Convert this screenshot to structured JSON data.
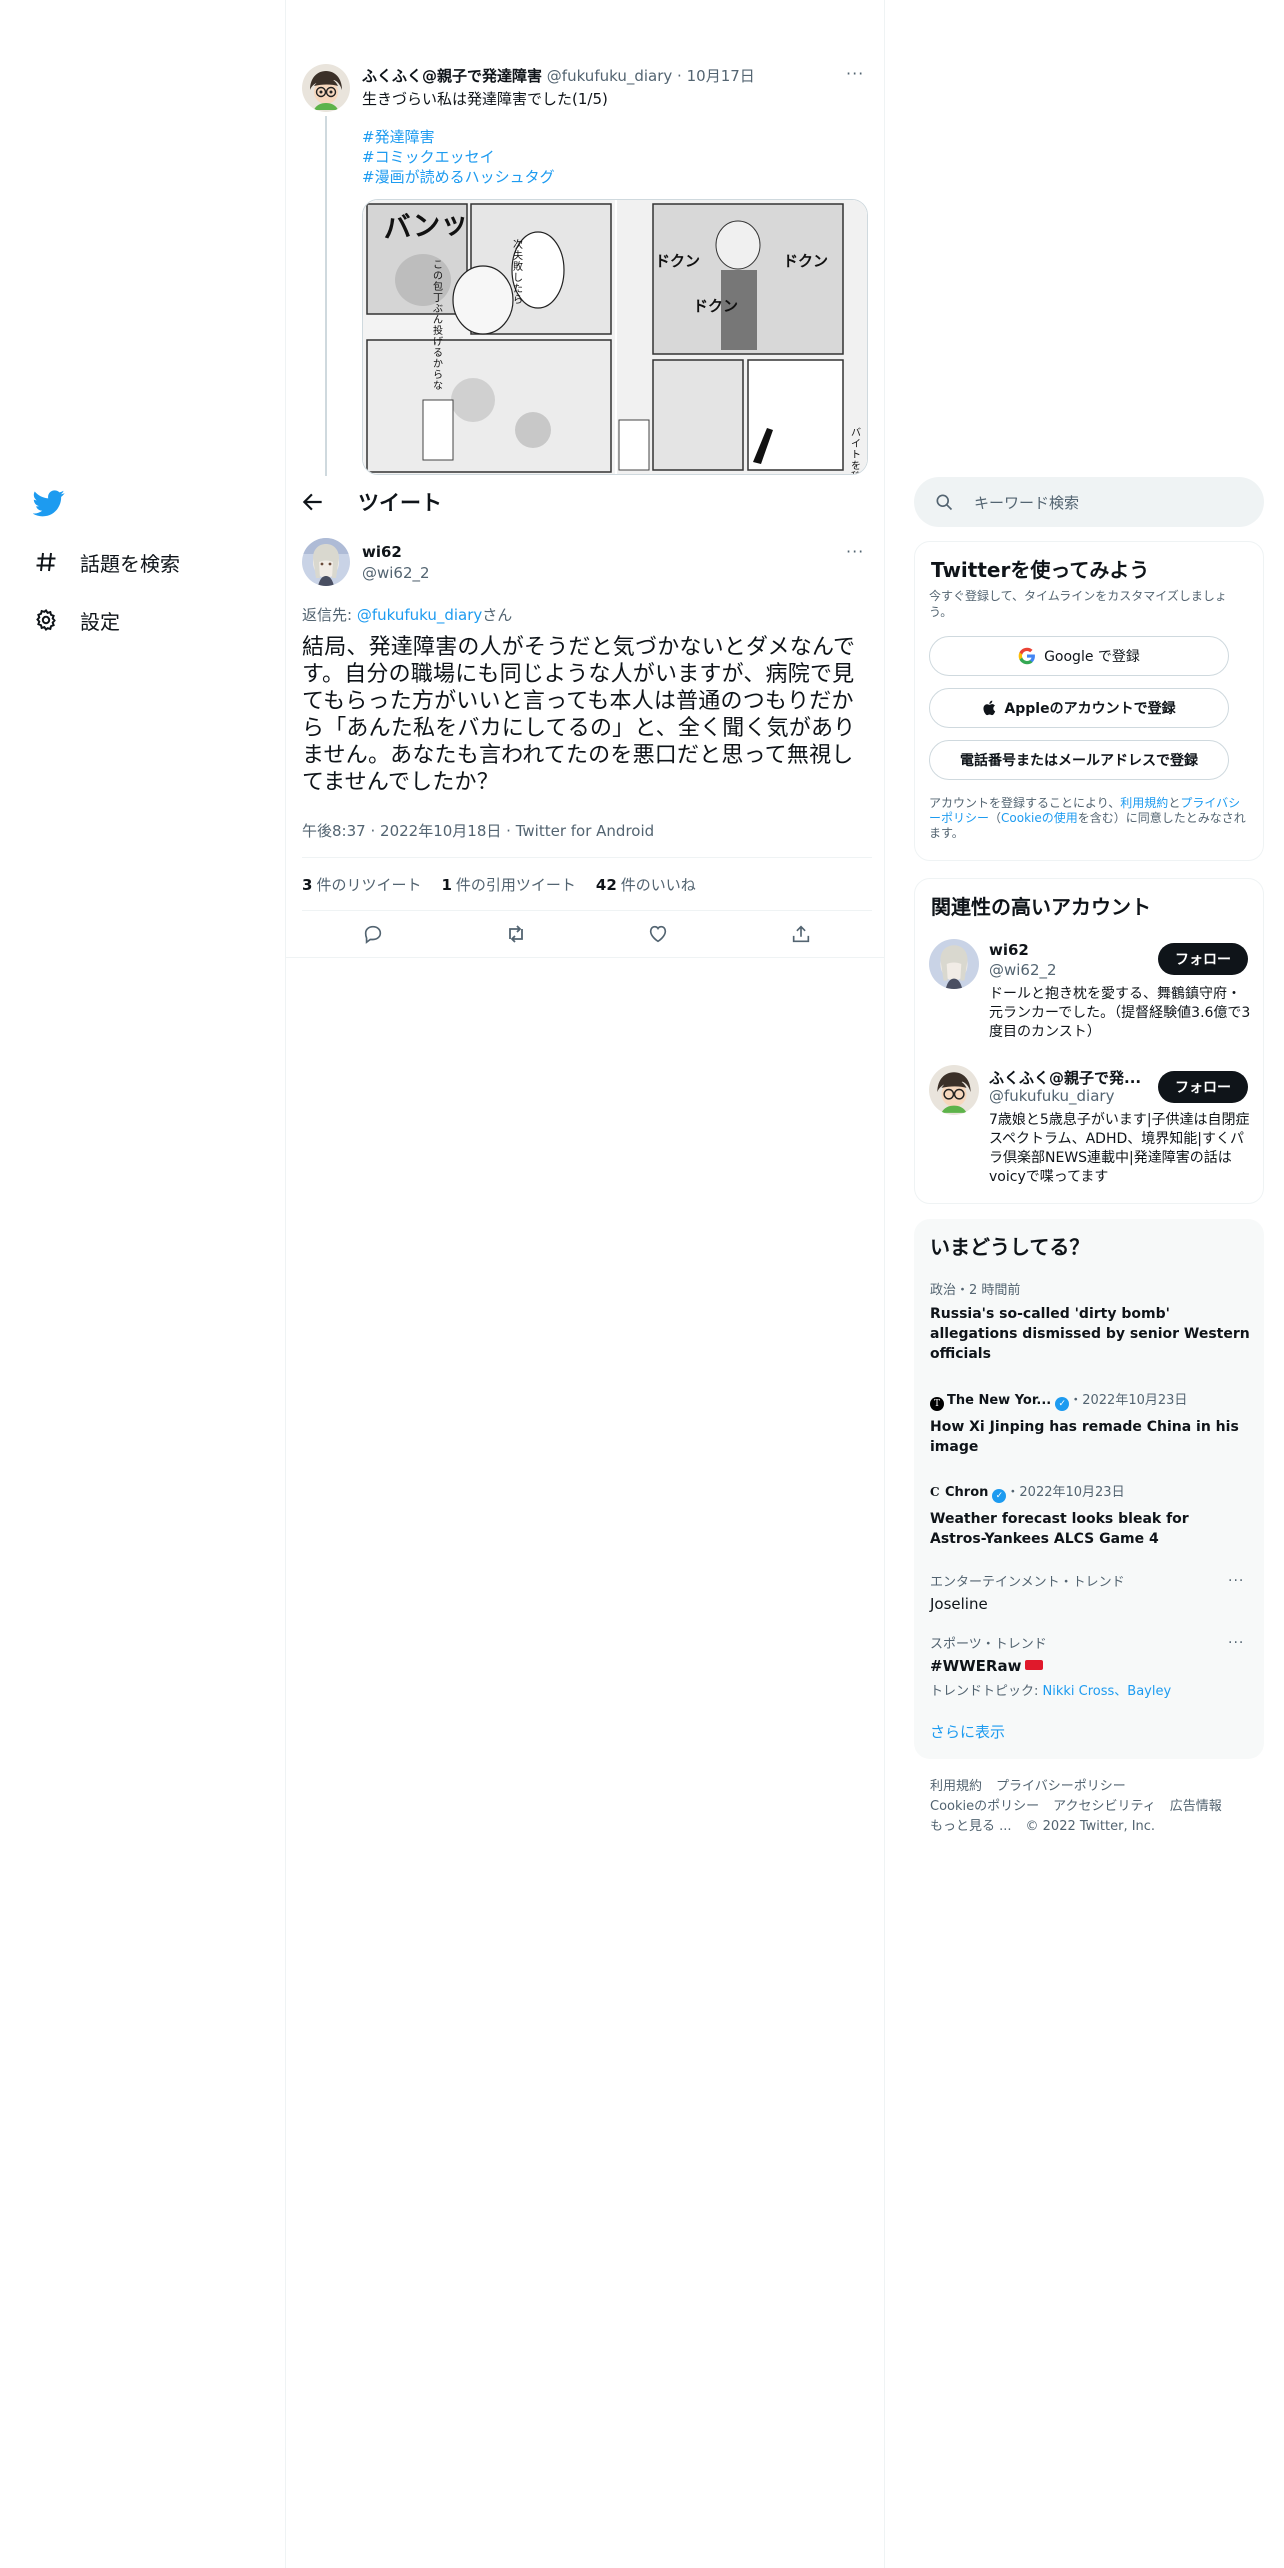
{
  "nav": {
    "logo": "twitter-bird-icon",
    "items": [
      {
        "label": "話題を検索",
        "icon": "hashtag-icon"
      },
      {
        "label": "設定",
        "icon": "gear-icon"
      }
    ]
  },
  "parent_tweet": {
    "name": "ふくふく@親子で発達障害",
    "handle": "@fukufuku_diary",
    "date": "10月17日",
    "text": "生きづらい私は発達障害でした(1/5)",
    "hashtags": [
      "#発達障害",
      "#コミックエッセイ",
      "#漫画が読めるハッシュタグ"
    ],
    "manga_left": {
      "sfx": "バンッ",
      "bubble1": "次失敗したら",
      "bubble2": "この包丁ぶん投げるからな"
    },
    "manga_right": {
      "sfx1": "ドクン",
      "sfx2": "ドクン",
      "sfx3": "ドクン",
      "caption": "バイトを辞"
    }
  },
  "header": {
    "title": "ツイート"
  },
  "focused_tweet": {
    "name": "wi62",
    "handle": "@wi62_2",
    "reply_prefix": "返信先: ",
    "reply_to": "@fukufuku_diary",
    "reply_suffix": "さん",
    "body": "結局、発達障害の人がそうだと気づかないとダメなんです。自分の職場にも同じような人がいますが、病院で見てもらった方がいいと言っても本人は普通のつもりだから「あんた私をバカにしてるの」と、全く聞く気がありません。あなたも言われてたのを悪口だと思って無視してませんでしたか？",
    "time": "午後8:37",
    "date": "2022年10月18日",
    "client": "Twitter for Android",
    "retweets": "3",
    "retweets_label": "件のリツイート",
    "quotes": "1",
    "quotes_label": "件の引用ツイート",
    "likes": "42",
    "likes_label": "件のいいね"
  },
  "search": {
    "placeholder": "キーワード検索"
  },
  "signup": {
    "title": "Twitterを使ってみよう",
    "subtitle": "今すぐ登録して、タイムラインをカスタマイズしましょう。",
    "google": "Google で登録",
    "apple": "Appleのアカウントで登録",
    "phone": "電話番号またはメールアドレスで登録",
    "terms_1": "アカウントを登録することにより、",
    "terms_link1": "利用規約",
    "terms_2": "と",
    "terms_link2": "プライバシーポリシー",
    "terms_3": "（",
    "terms_link3": "Cookieの使用",
    "terms_4": "を含む）に同意したとみなされます。"
  },
  "relevant": {
    "title": "関連性の高いアカウント",
    "follow_label": "フォロー",
    "accounts": [
      {
        "name": "wi62",
        "handle": "@wi62_2",
        "bio": "ドールと抱き枕を愛する、舞鶴鎮守府・元ランカーでした。（提督経験値3.6億で3度目のカンスト）"
      },
      {
        "name": "ふくふく@親子で発...",
        "handle": "@fukufuku_diary",
        "bio": "7歳娘と5歳息子がいます|子供達は自閉症スペクトラム、ADHD、境界知能|すくパラ倶楽部NEWS連載中|発達障害の話はvoicyで喋ってます"
      }
    ]
  },
  "trends": {
    "title": "いまどうしてる？",
    "items": [
      {
        "meta": "政治・2 時間前",
        "title": "Russia's so-called 'dirty bomb' allegations dismissed by senior Western officials"
      },
      {
        "source": "The New Yor...",
        "date": "・2022年10月23日",
        "title": "How Xi Jinping has remade China in his image"
      },
      {
        "source": "Chron",
        "date": "・2022年10月23日",
        "title": "Weather forecast looks bleak for Astros-Yankees ALCS Game 4"
      },
      {
        "meta": "エンターテインメント・トレンド",
        "title": "Joseline"
      },
      {
        "meta": "スポーツ・トレンド",
        "title": "#WWERaw",
        "topic_label": "トレンドトピック: ",
        "topics": "Nikki Cross、Bayley"
      }
    ],
    "more": "さらに表示"
  },
  "footer": {
    "row1": [
      "利用規約",
      "プライバシーポリシー"
    ],
    "row2": [
      "Cookieのポリシー",
      "アクセシビリティ",
      "広告情報"
    ],
    "row3": [
      "もっと見る ...",
      "© 2022 Twitter, Inc."
    ]
  },
  "colors": {
    "accent": "#1d9bf0",
    "text": "#0f1419",
    "muted": "#536471",
    "border": "#eff3f4"
  }
}
